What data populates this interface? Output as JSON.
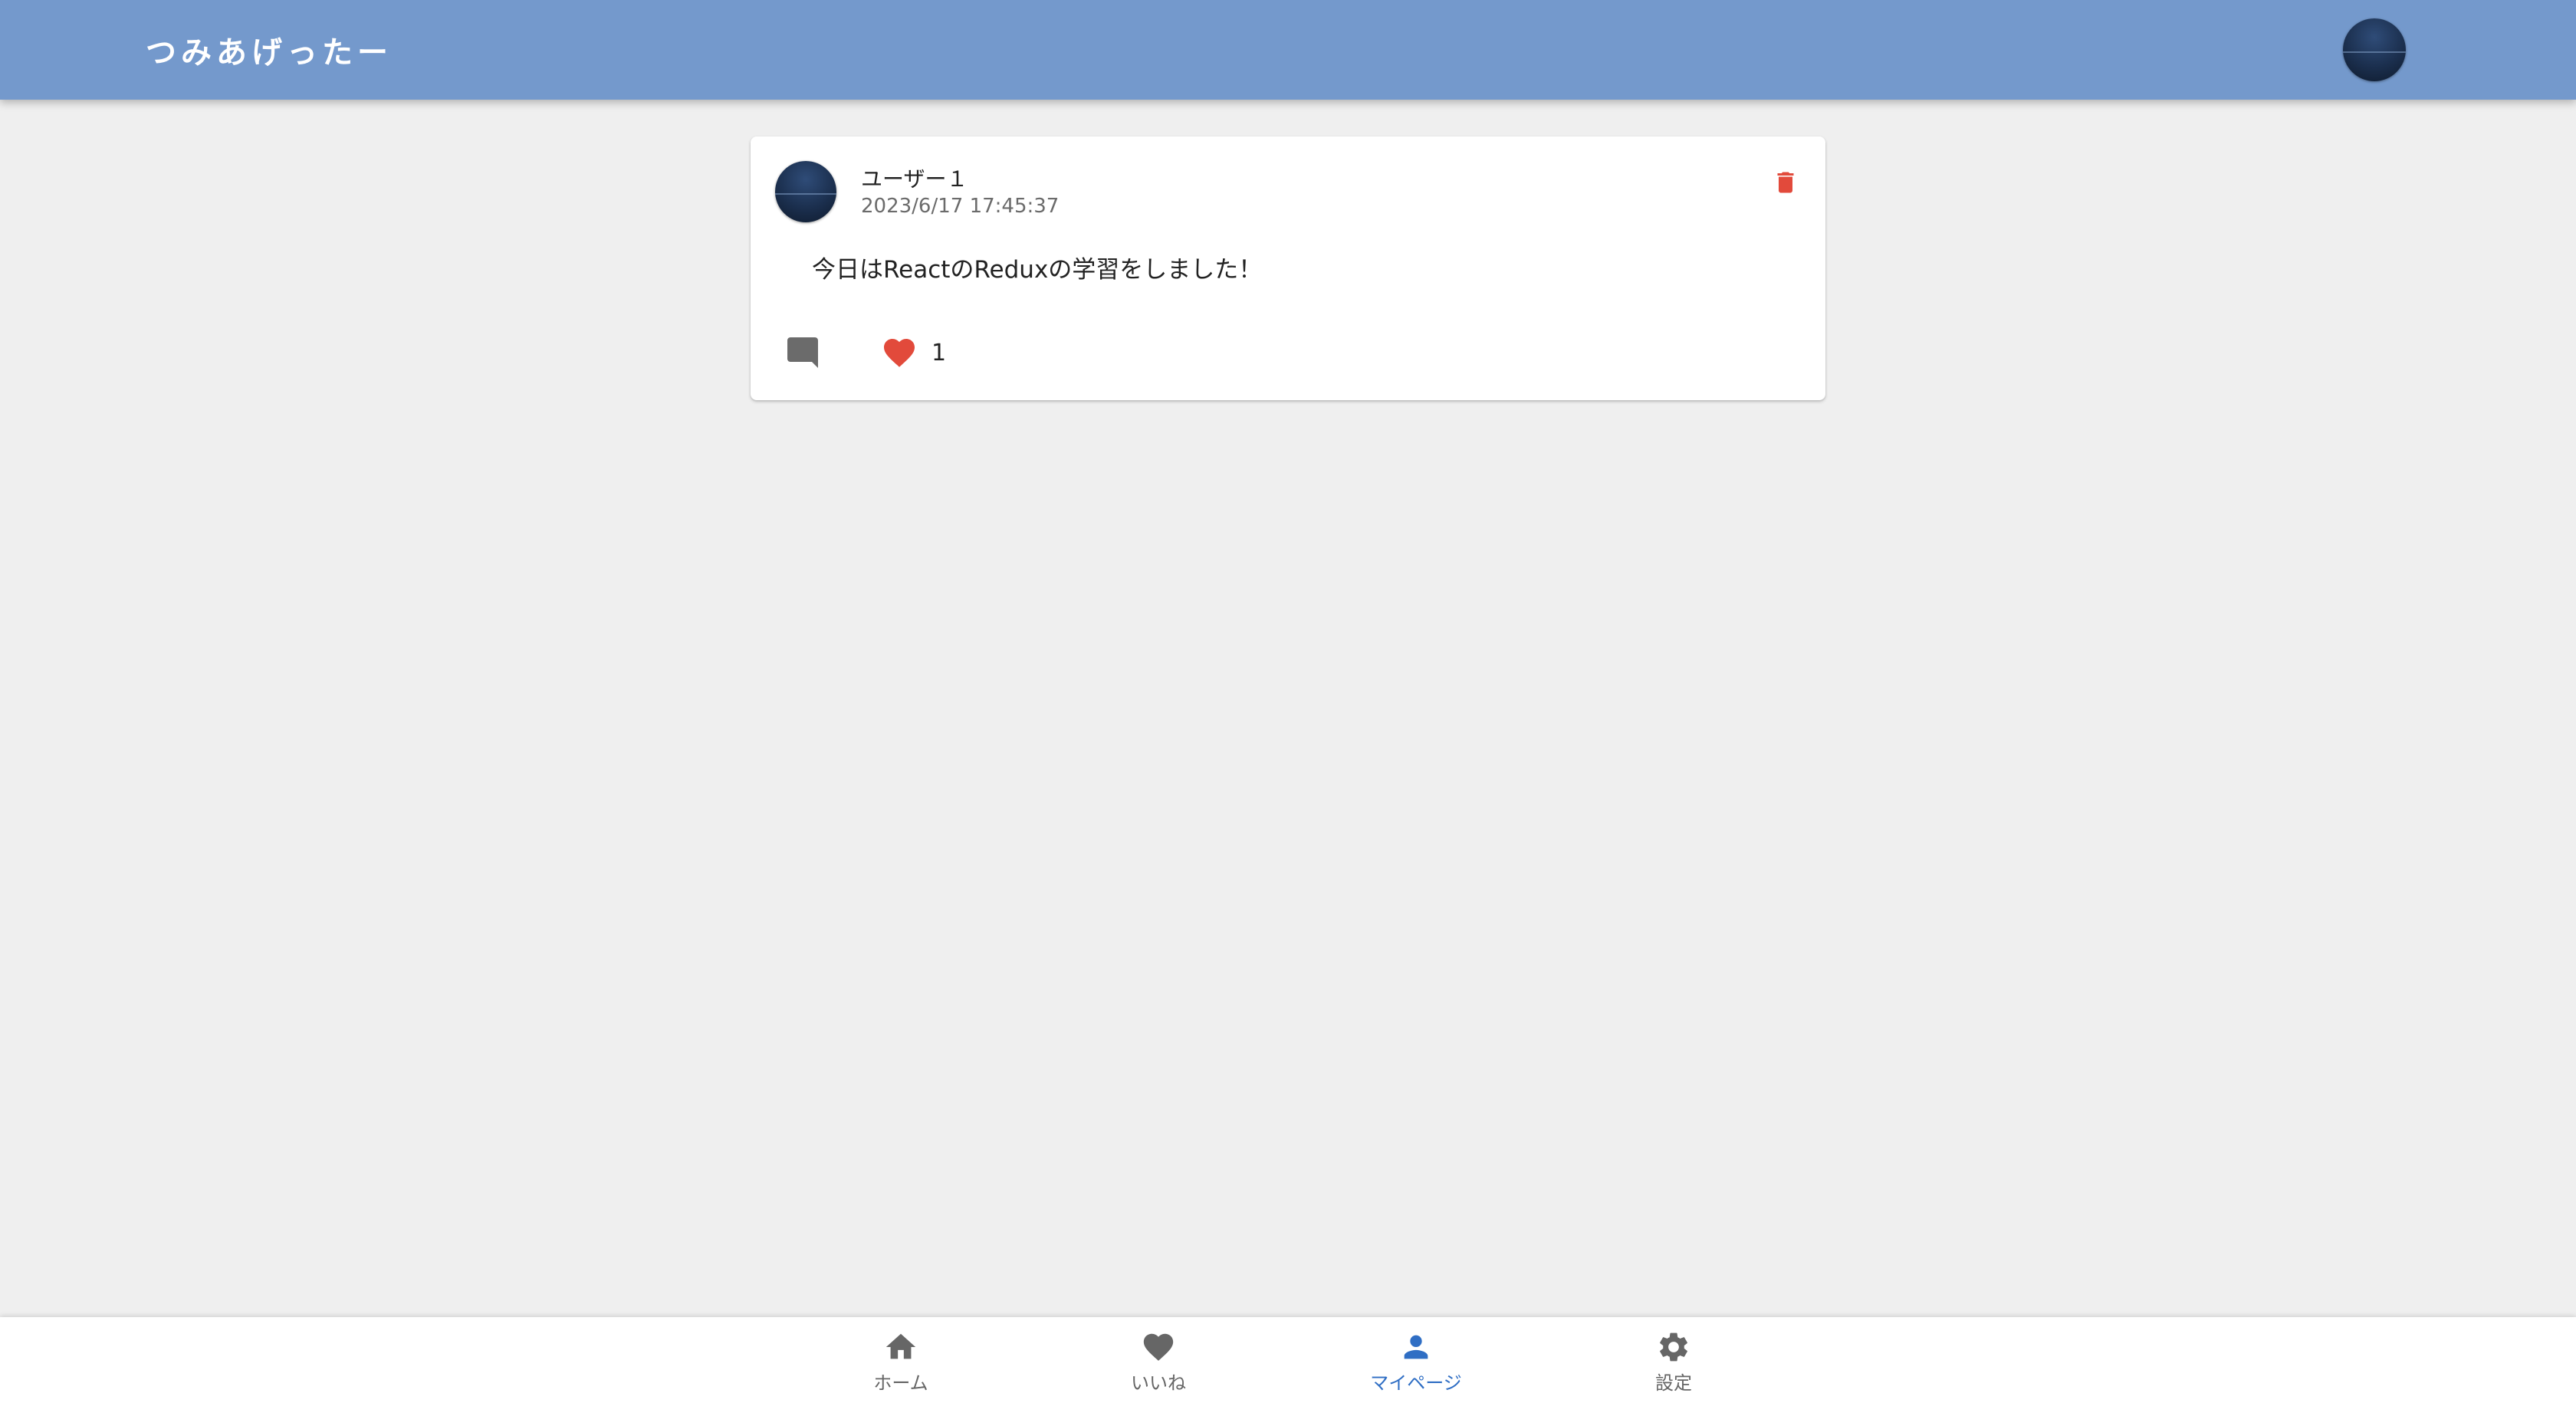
{
  "app": {
    "title": "つみあげったー"
  },
  "post": {
    "user_name": "ユーザー１",
    "timestamp": "2023/6/17 17:45:37",
    "content": "今日はReactのReduxの学習をしました！",
    "like_count": "1",
    "icons": {
      "delete": "trash-icon",
      "comment": "comment-icon",
      "like": "heart-icon"
    }
  },
  "bottom_nav": {
    "items": [
      {
        "label": "ホーム",
        "icon": "home-icon"
      },
      {
        "label": "いいね",
        "icon": "heart-icon"
      },
      {
        "label": "マイページ",
        "icon": "person-icon"
      },
      {
        "label": "設定",
        "icon": "gear-icon"
      }
    ],
    "active": "マイページ"
  },
  "colors": {
    "header": "#7499cc",
    "background": "#efefef",
    "delete": "#e24a3b",
    "like": "#e24a3b",
    "active_nav": "#2f6ec4",
    "inactive_nav": "#666666"
  }
}
